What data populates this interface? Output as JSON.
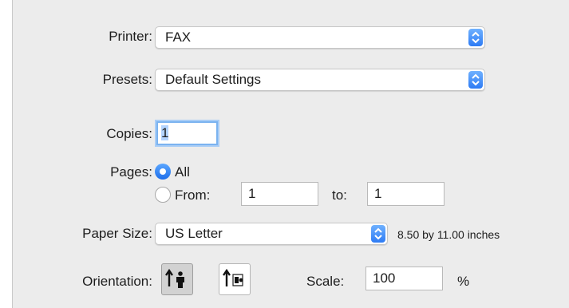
{
  "printer": {
    "label": "Printer:",
    "value": "FAX"
  },
  "presets": {
    "label": "Presets:",
    "value": "Default Settings"
  },
  "copies": {
    "label": "Copies:",
    "value": "1"
  },
  "pages": {
    "label": "Pages:",
    "all_label": "All",
    "from_label": "From:",
    "from_value": "1",
    "to_label": "to:",
    "to_value": "1",
    "selected": "All"
  },
  "paper_size": {
    "label": "Paper Size:",
    "value": "US Letter",
    "dimensions": "8.50 by 11.00 inches"
  },
  "orientation": {
    "label": "Orientation:",
    "portrait_icon": "portrait-orientation-icon",
    "landscape_icon": "landscape-orientation-icon",
    "selected": "portrait"
  },
  "scale": {
    "label": "Scale:",
    "value": "100",
    "unit": "%"
  },
  "colors": {
    "accent": "#2d7bf4",
    "panel": "#ececec",
    "focus_ring": "#7bb3f0"
  }
}
